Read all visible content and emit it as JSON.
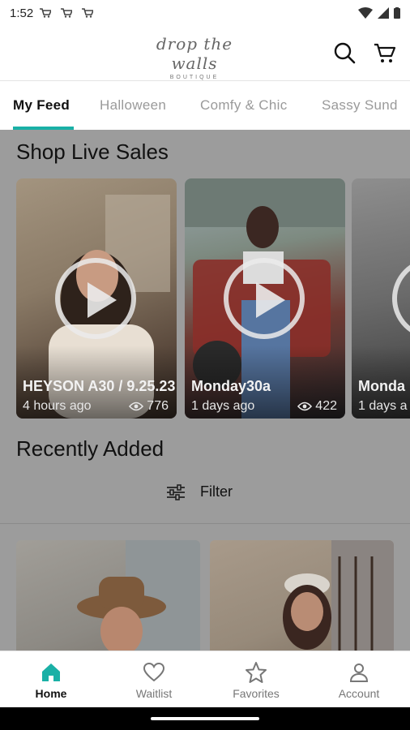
{
  "status_bar": {
    "time": "1:52"
  },
  "header": {
    "logo_script": "drop the walls",
    "logo_sub": "BOUTIQUE",
    "icons": [
      "search-icon",
      "cart-icon"
    ]
  },
  "tabs": [
    "My Feed",
    "Halloween",
    "Comfy & Chic",
    "Sassy Sund"
  ],
  "live": {
    "title": "Shop Live Sales",
    "cards": [
      {
        "title": "HEYSON A30 / 9.25.23",
        "time": "4 hours ago",
        "views": "776"
      },
      {
        "title": "Monday30a",
        "time": "1 days ago",
        "views": "422"
      },
      {
        "title": "Monda",
        "time": "1 days a",
        "views": ""
      }
    ]
  },
  "recent": {
    "title": "Recently Added",
    "filter_label": "Filter"
  },
  "bottom_nav": [
    {
      "label": "Home",
      "icon": "home-icon"
    },
    {
      "label": "Waitlist",
      "icon": "heart-icon"
    },
    {
      "label": "Favorites",
      "icon": "star-icon"
    },
    {
      "label": "Account",
      "icon": "person-icon"
    }
  ],
  "colors": {
    "accent": "#1ab0a6",
    "overlay": "#9c9c9c"
  }
}
